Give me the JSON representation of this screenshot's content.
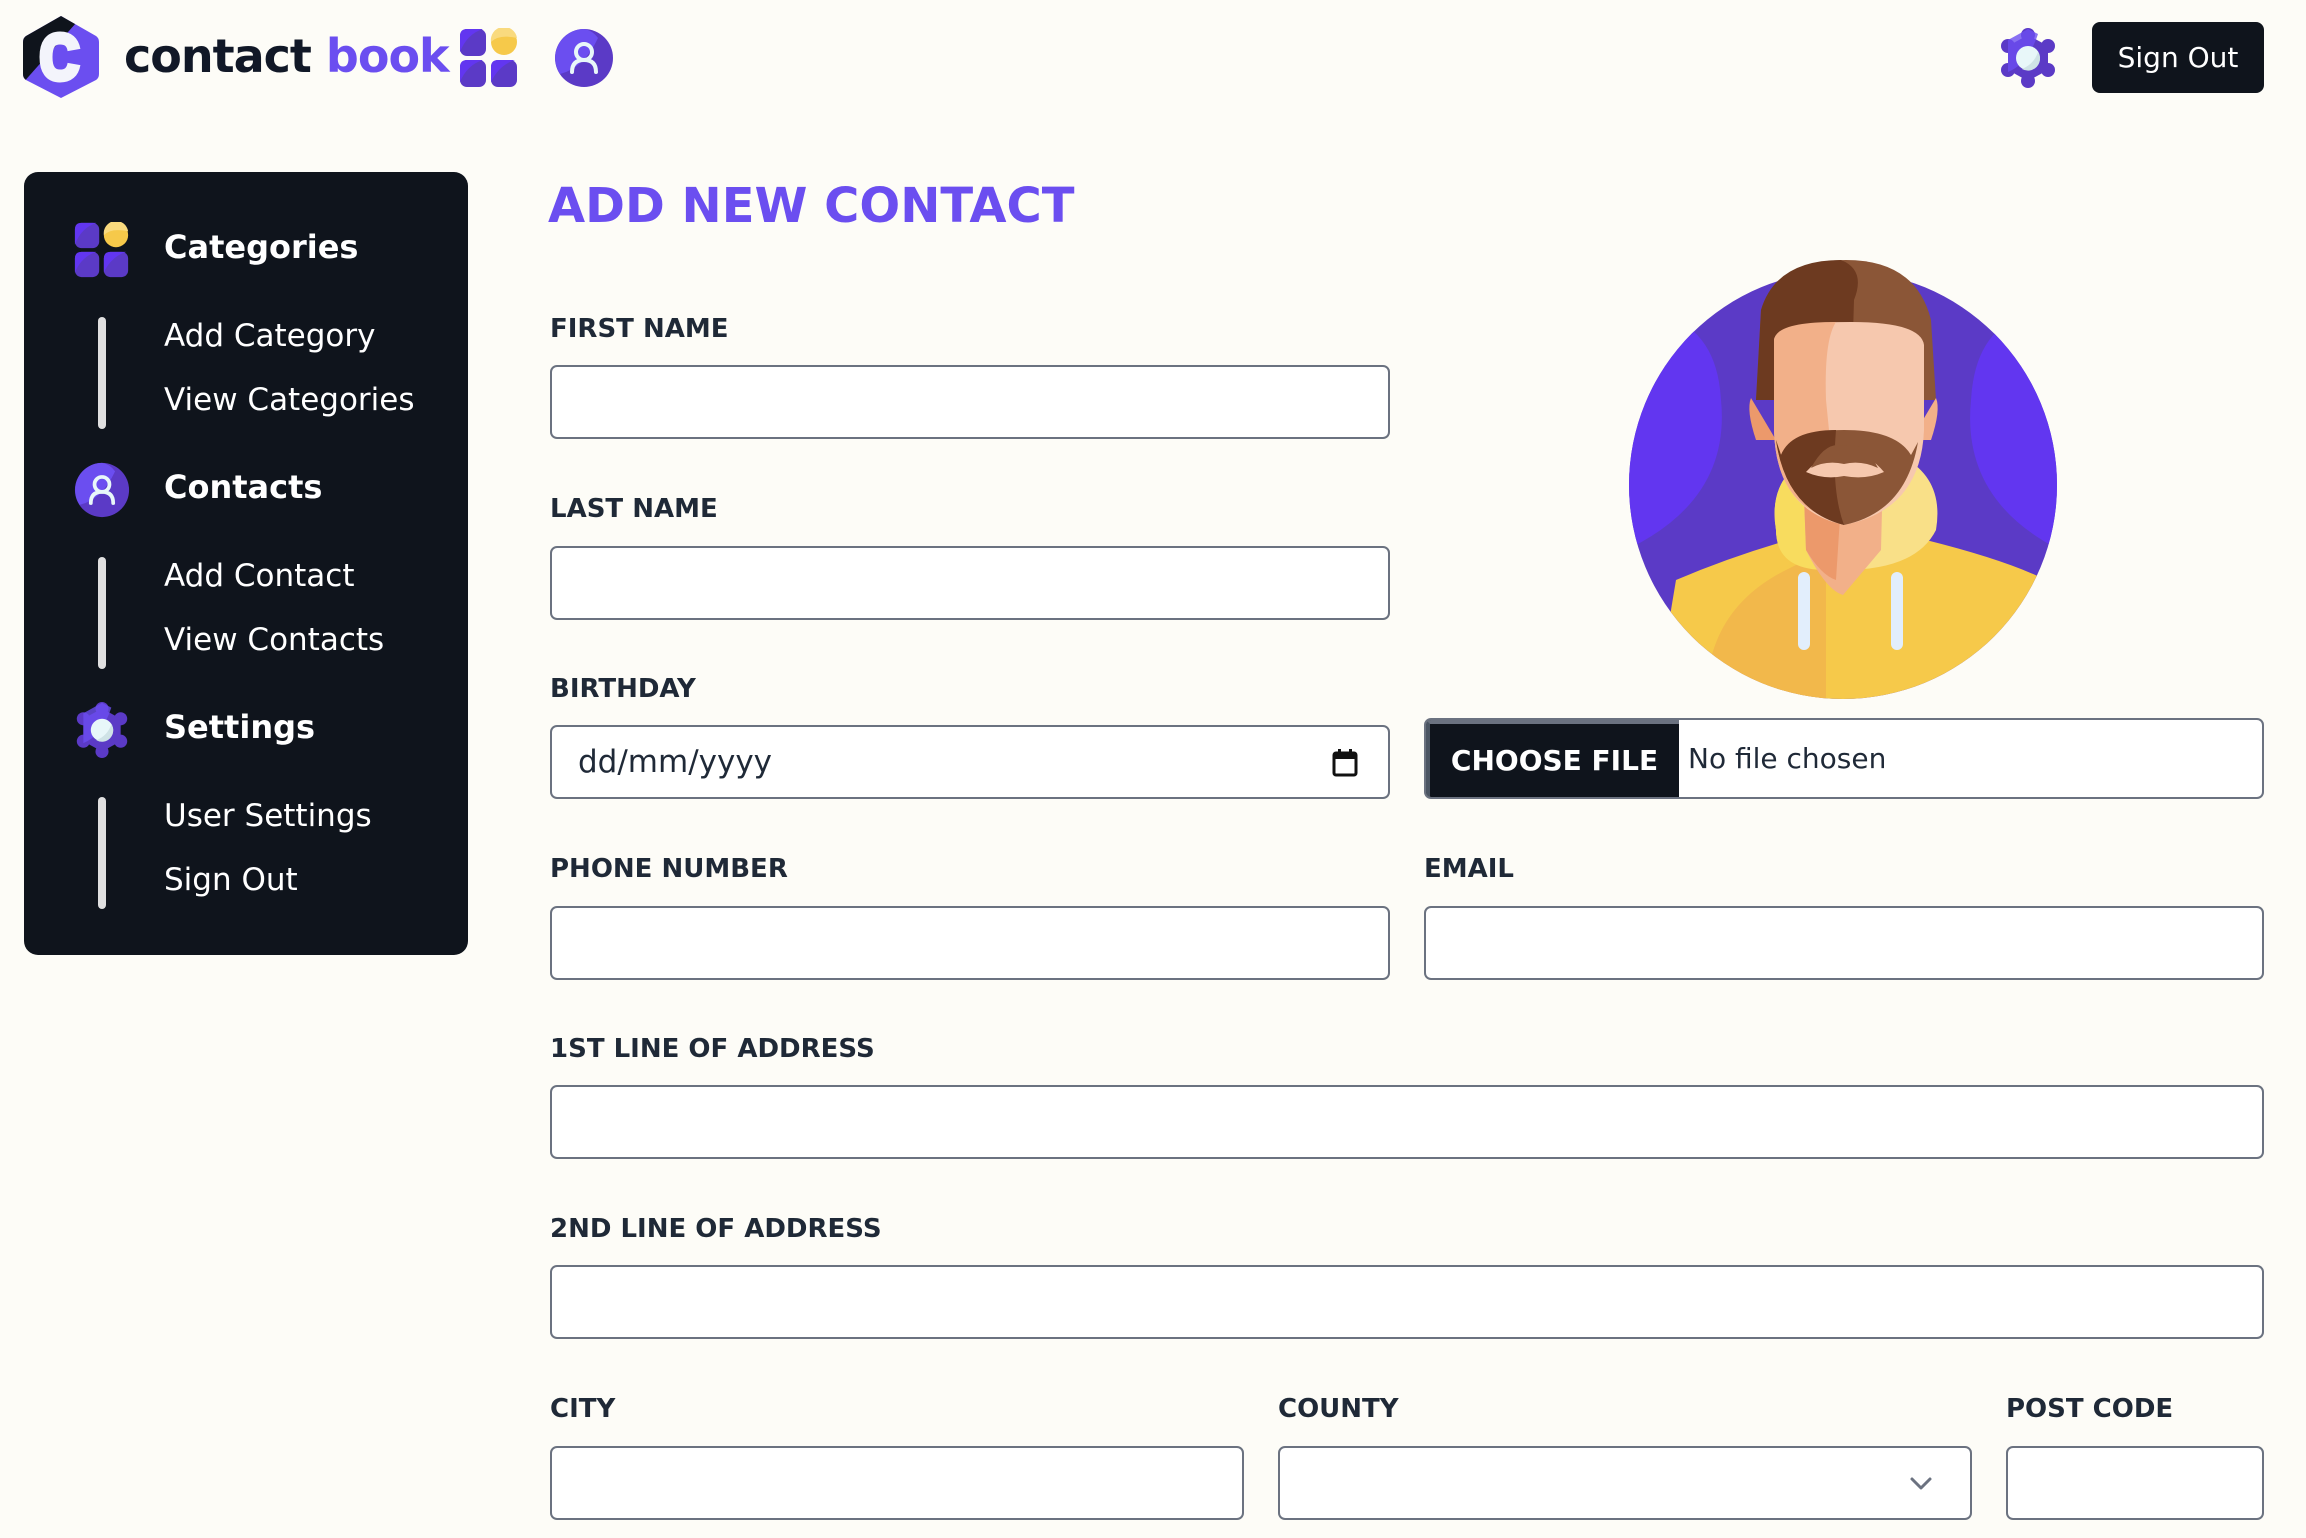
{
  "header": {
    "brand_part1": "contact",
    "brand_part2": "book",
    "sign_out_label": "Sign Out",
    "icons": [
      "logo-hexagon-c",
      "categories-icon",
      "contacts-person-icon",
      "settings-gear-icon"
    ]
  },
  "sidebar": {
    "sections": [
      {
        "title": "Categories",
        "icon": "categories-icon",
        "links": [
          "Add Category",
          "View Categories"
        ]
      },
      {
        "title": "Contacts",
        "icon": "person-icon",
        "links": [
          "Add Contact",
          "View Contacts"
        ]
      },
      {
        "title": "Settings",
        "icon": "gear-icon",
        "links": [
          "User Settings",
          "Sign Out"
        ]
      }
    ]
  },
  "form": {
    "title": "ADD NEW CONTACT",
    "fields": {
      "first_name": {
        "label": "FIRST NAME",
        "value": ""
      },
      "last_name": {
        "label": "LAST NAME",
        "value": ""
      },
      "birthday": {
        "label": "BIRTHDAY",
        "placeholder": "dd/mm/yyyy",
        "value": ""
      },
      "phone": {
        "label": "PHONE NUMBER",
        "value": ""
      },
      "email": {
        "label": "EMAIL",
        "value": ""
      },
      "address1": {
        "label": "1ST LINE OF ADDRESS",
        "value": ""
      },
      "address2": {
        "label": "2ND LINE OF ADDRESS",
        "value": ""
      },
      "city": {
        "label": "CITY",
        "value": ""
      },
      "county": {
        "label": "COUNTY",
        "selected": ""
      },
      "post_code": {
        "label": "POST CODE",
        "value": ""
      }
    },
    "photo": {
      "button_label": "CHOOSE FILE",
      "status": "No file chosen",
      "avatar": "default-avatar-bearded-man"
    }
  },
  "colors": {
    "accent": "#6b4ef0",
    "dark": "#0f141c",
    "background": "#fdfcf7",
    "border": "#6b7280",
    "yellow": "#f6c94a"
  }
}
